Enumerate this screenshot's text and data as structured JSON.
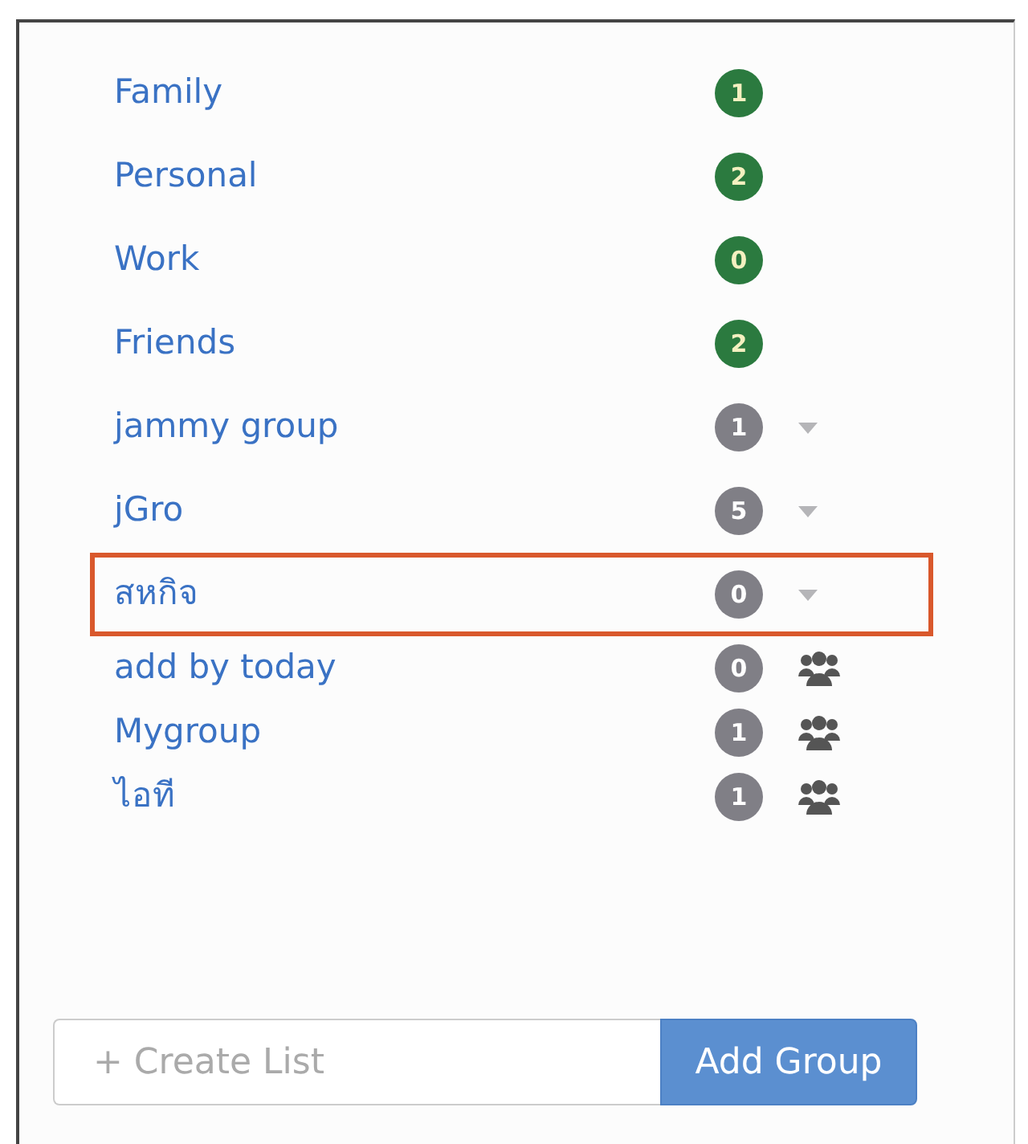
{
  "groups": [
    {
      "name": "Family",
      "count": "1",
      "kind": "default",
      "highlighted": false
    },
    {
      "name": "Personal",
      "count": "2",
      "kind": "default",
      "highlighted": false
    },
    {
      "name": "Work",
      "count": "0",
      "kind": "default",
      "highlighted": false
    },
    {
      "name": "Friends",
      "count": "2",
      "kind": "default",
      "highlighted": false
    },
    {
      "name": "jammy group",
      "count": "1",
      "kind": "owned",
      "highlighted": false
    },
    {
      "name": "jGro",
      "count": "5",
      "kind": "owned",
      "highlighted": false
    },
    {
      "name": "สหกิจ",
      "count": "0",
      "kind": "owned",
      "highlighted": true
    },
    {
      "name": "add by today",
      "count": "0",
      "kind": "shared",
      "highlighted": false
    },
    {
      "name": "Mygroup",
      "count": "1",
      "kind": "shared",
      "highlighted": false
    },
    {
      "name": "ไอที",
      "count": "1",
      "kind": "shared",
      "highlighted": false
    }
  ],
  "create": {
    "placeholder": "+ Create List",
    "button": "Add Group"
  }
}
